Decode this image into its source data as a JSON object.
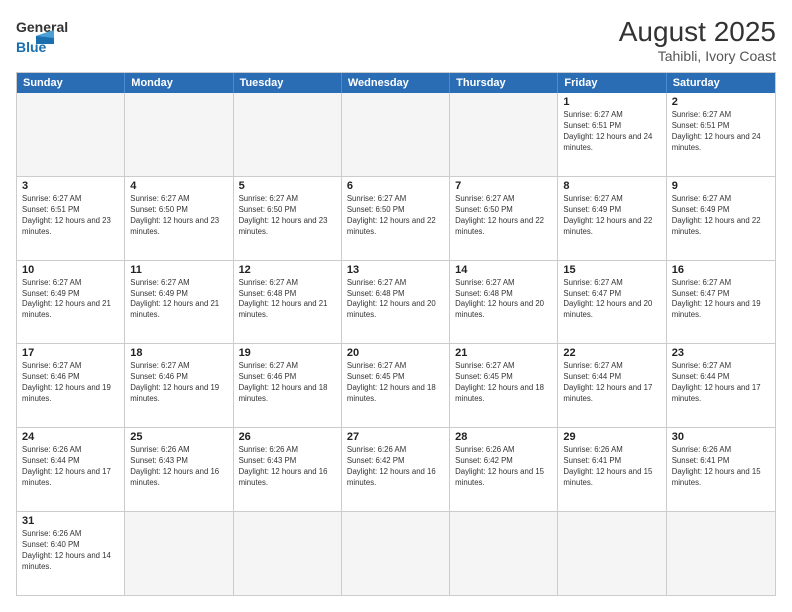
{
  "header": {
    "logo_general": "General",
    "logo_blue": "Blue",
    "month_year": "August 2025",
    "location": "Tahibli, Ivory Coast"
  },
  "days_of_week": [
    "Sunday",
    "Monday",
    "Tuesday",
    "Wednesday",
    "Thursday",
    "Friday",
    "Saturday"
  ],
  "weeks": [
    [
      {
        "day": "",
        "info": ""
      },
      {
        "day": "",
        "info": ""
      },
      {
        "day": "",
        "info": ""
      },
      {
        "day": "",
        "info": ""
      },
      {
        "day": "",
        "info": ""
      },
      {
        "day": "1",
        "info": "Sunrise: 6:27 AM\nSunset: 6:51 PM\nDaylight: 12 hours and 24 minutes."
      },
      {
        "day": "2",
        "info": "Sunrise: 6:27 AM\nSunset: 6:51 PM\nDaylight: 12 hours and 24 minutes."
      }
    ],
    [
      {
        "day": "3",
        "info": "Sunrise: 6:27 AM\nSunset: 6:51 PM\nDaylight: 12 hours and 23 minutes."
      },
      {
        "day": "4",
        "info": "Sunrise: 6:27 AM\nSunset: 6:50 PM\nDaylight: 12 hours and 23 minutes."
      },
      {
        "day": "5",
        "info": "Sunrise: 6:27 AM\nSunset: 6:50 PM\nDaylight: 12 hours and 23 minutes."
      },
      {
        "day": "6",
        "info": "Sunrise: 6:27 AM\nSunset: 6:50 PM\nDaylight: 12 hours and 22 minutes."
      },
      {
        "day": "7",
        "info": "Sunrise: 6:27 AM\nSunset: 6:50 PM\nDaylight: 12 hours and 22 minutes."
      },
      {
        "day": "8",
        "info": "Sunrise: 6:27 AM\nSunset: 6:49 PM\nDaylight: 12 hours and 22 minutes."
      },
      {
        "day": "9",
        "info": "Sunrise: 6:27 AM\nSunset: 6:49 PM\nDaylight: 12 hours and 22 minutes."
      }
    ],
    [
      {
        "day": "10",
        "info": "Sunrise: 6:27 AM\nSunset: 6:49 PM\nDaylight: 12 hours and 21 minutes."
      },
      {
        "day": "11",
        "info": "Sunrise: 6:27 AM\nSunset: 6:49 PM\nDaylight: 12 hours and 21 minutes."
      },
      {
        "day": "12",
        "info": "Sunrise: 6:27 AM\nSunset: 6:48 PM\nDaylight: 12 hours and 21 minutes."
      },
      {
        "day": "13",
        "info": "Sunrise: 6:27 AM\nSunset: 6:48 PM\nDaylight: 12 hours and 20 minutes."
      },
      {
        "day": "14",
        "info": "Sunrise: 6:27 AM\nSunset: 6:48 PM\nDaylight: 12 hours and 20 minutes."
      },
      {
        "day": "15",
        "info": "Sunrise: 6:27 AM\nSunset: 6:47 PM\nDaylight: 12 hours and 20 minutes."
      },
      {
        "day": "16",
        "info": "Sunrise: 6:27 AM\nSunset: 6:47 PM\nDaylight: 12 hours and 19 minutes."
      }
    ],
    [
      {
        "day": "17",
        "info": "Sunrise: 6:27 AM\nSunset: 6:46 PM\nDaylight: 12 hours and 19 minutes."
      },
      {
        "day": "18",
        "info": "Sunrise: 6:27 AM\nSunset: 6:46 PM\nDaylight: 12 hours and 19 minutes."
      },
      {
        "day": "19",
        "info": "Sunrise: 6:27 AM\nSunset: 6:46 PM\nDaylight: 12 hours and 18 minutes."
      },
      {
        "day": "20",
        "info": "Sunrise: 6:27 AM\nSunset: 6:45 PM\nDaylight: 12 hours and 18 minutes."
      },
      {
        "day": "21",
        "info": "Sunrise: 6:27 AM\nSunset: 6:45 PM\nDaylight: 12 hours and 18 minutes."
      },
      {
        "day": "22",
        "info": "Sunrise: 6:27 AM\nSunset: 6:44 PM\nDaylight: 12 hours and 17 minutes."
      },
      {
        "day": "23",
        "info": "Sunrise: 6:27 AM\nSunset: 6:44 PM\nDaylight: 12 hours and 17 minutes."
      }
    ],
    [
      {
        "day": "24",
        "info": "Sunrise: 6:26 AM\nSunset: 6:44 PM\nDaylight: 12 hours and 17 minutes."
      },
      {
        "day": "25",
        "info": "Sunrise: 6:26 AM\nSunset: 6:43 PM\nDaylight: 12 hours and 16 minutes."
      },
      {
        "day": "26",
        "info": "Sunrise: 6:26 AM\nSunset: 6:43 PM\nDaylight: 12 hours and 16 minutes."
      },
      {
        "day": "27",
        "info": "Sunrise: 6:26 AM\nSunset: 6:42 PM\nDaylight: 12 hours and 16 minutes."
      },
      {
        "day": "28",
        "info": "Sunrise: 6:26 AM\nSunset: 6:42 PM\nDaylight: 12 hours and 15 minutes."
      },
      {
        "day": "29",
        "info": "Sunrise: 6:26 AM\nSunset: 6:41 PM\nDaylight: 12 hours and 15 minutes."
      },
      {
        "day": "30",
        "info": "Sunrise: 6:26 AM\nSunset: 6:41 PM\nDaylight: 12 hours and 15 minutes."
      }
    ],
    [
      {
        "day": "31",
        "info": "Sunrise: 6:26 AM\nSunset: 6:40 PM\nDaylight: 12 hours and 14 minutes."
      },
      {
        "day": "",
        "info": ""
      },
      {
        "day": "",
        "info": ""
      },
      {
        "day": "",
        "info": ""
      },
      {
        "day": "",
        "info": ""
      },
      {
        "day": "",
        "info": ""
      },
      {
        "day": "",
        "info": ""
      }
    ]
  ]
}
